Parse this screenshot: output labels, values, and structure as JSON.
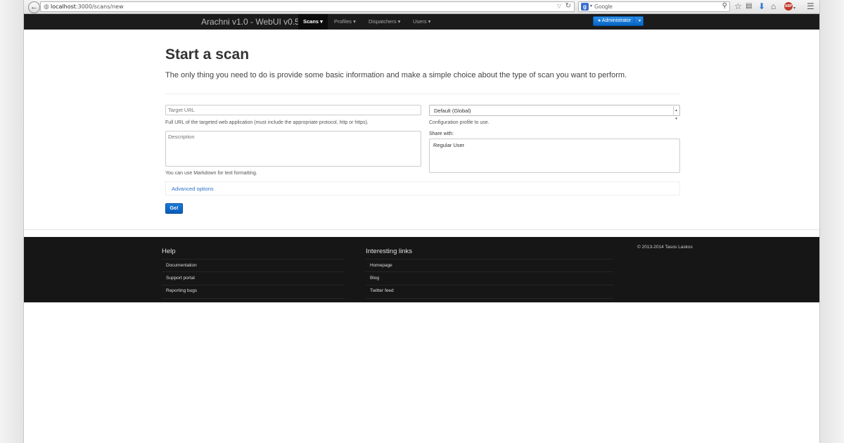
{
  "browser": {
    "back_glyph": "←",
    "url_host": "localhost",
    "url_rest": ":3000/scans/new",
    "search_engine_letter": "g",
    "search_placeholder": "Google"
  },
  "navbar": {
    "brand": "Arachni v1.0 - WebUI v0.5",
    "items": [
      {
        "label": "Scans ▾",
        "active": true
      },
      {
        "label": "Profiles ▾"
      },
      {
        "label": "Dispatchers ▾"
      },
      {
        "label": "Users ▾"
      }
    ],
    "user_button": "Administrator"
  },
  "main": {
    "title": "Start a scan",
    "lead": "The only thing you need to do is provide some basic information and make a simple choice about the type of scan you want to perform.",
    "target_url_placeholder": "Target URL",
    "target_url_help": "Full URL of the targeted web application (must include the appropriate protocol, http or https).",
    "description_placeholder": "Description",
    "description_help": "You can use Markdown for text formatting.",
    "profile_selected": "Default (Global)",
    "profile_help": "Configuration profile to use.",
    "share_label": "Share with:",
    "share_options": [
      "Regular User"
    ],
    "advanced_link": "Advanced options",
    "go_button": "Go!"
  },
  "footer": {
    "help_heading": "Help",
    "help_links": [
      "Documentation",
      "Support portal",
      "Reporting bugs"
    ],
    "links_heading": "Interesting links",
    "links": [
      "Homepage",
      "Blog",
      "Twitter feed"
    ],
    "copyright": "© 2013-2014 Tasos Laskos"
  },
  "colors": {
    "navbar_bg": "#1b1b1b",
    "footer_bg": "#161616",
    "primary_button": "#0a6fd0",
    "link": "#2a6fc9"
  }
}
